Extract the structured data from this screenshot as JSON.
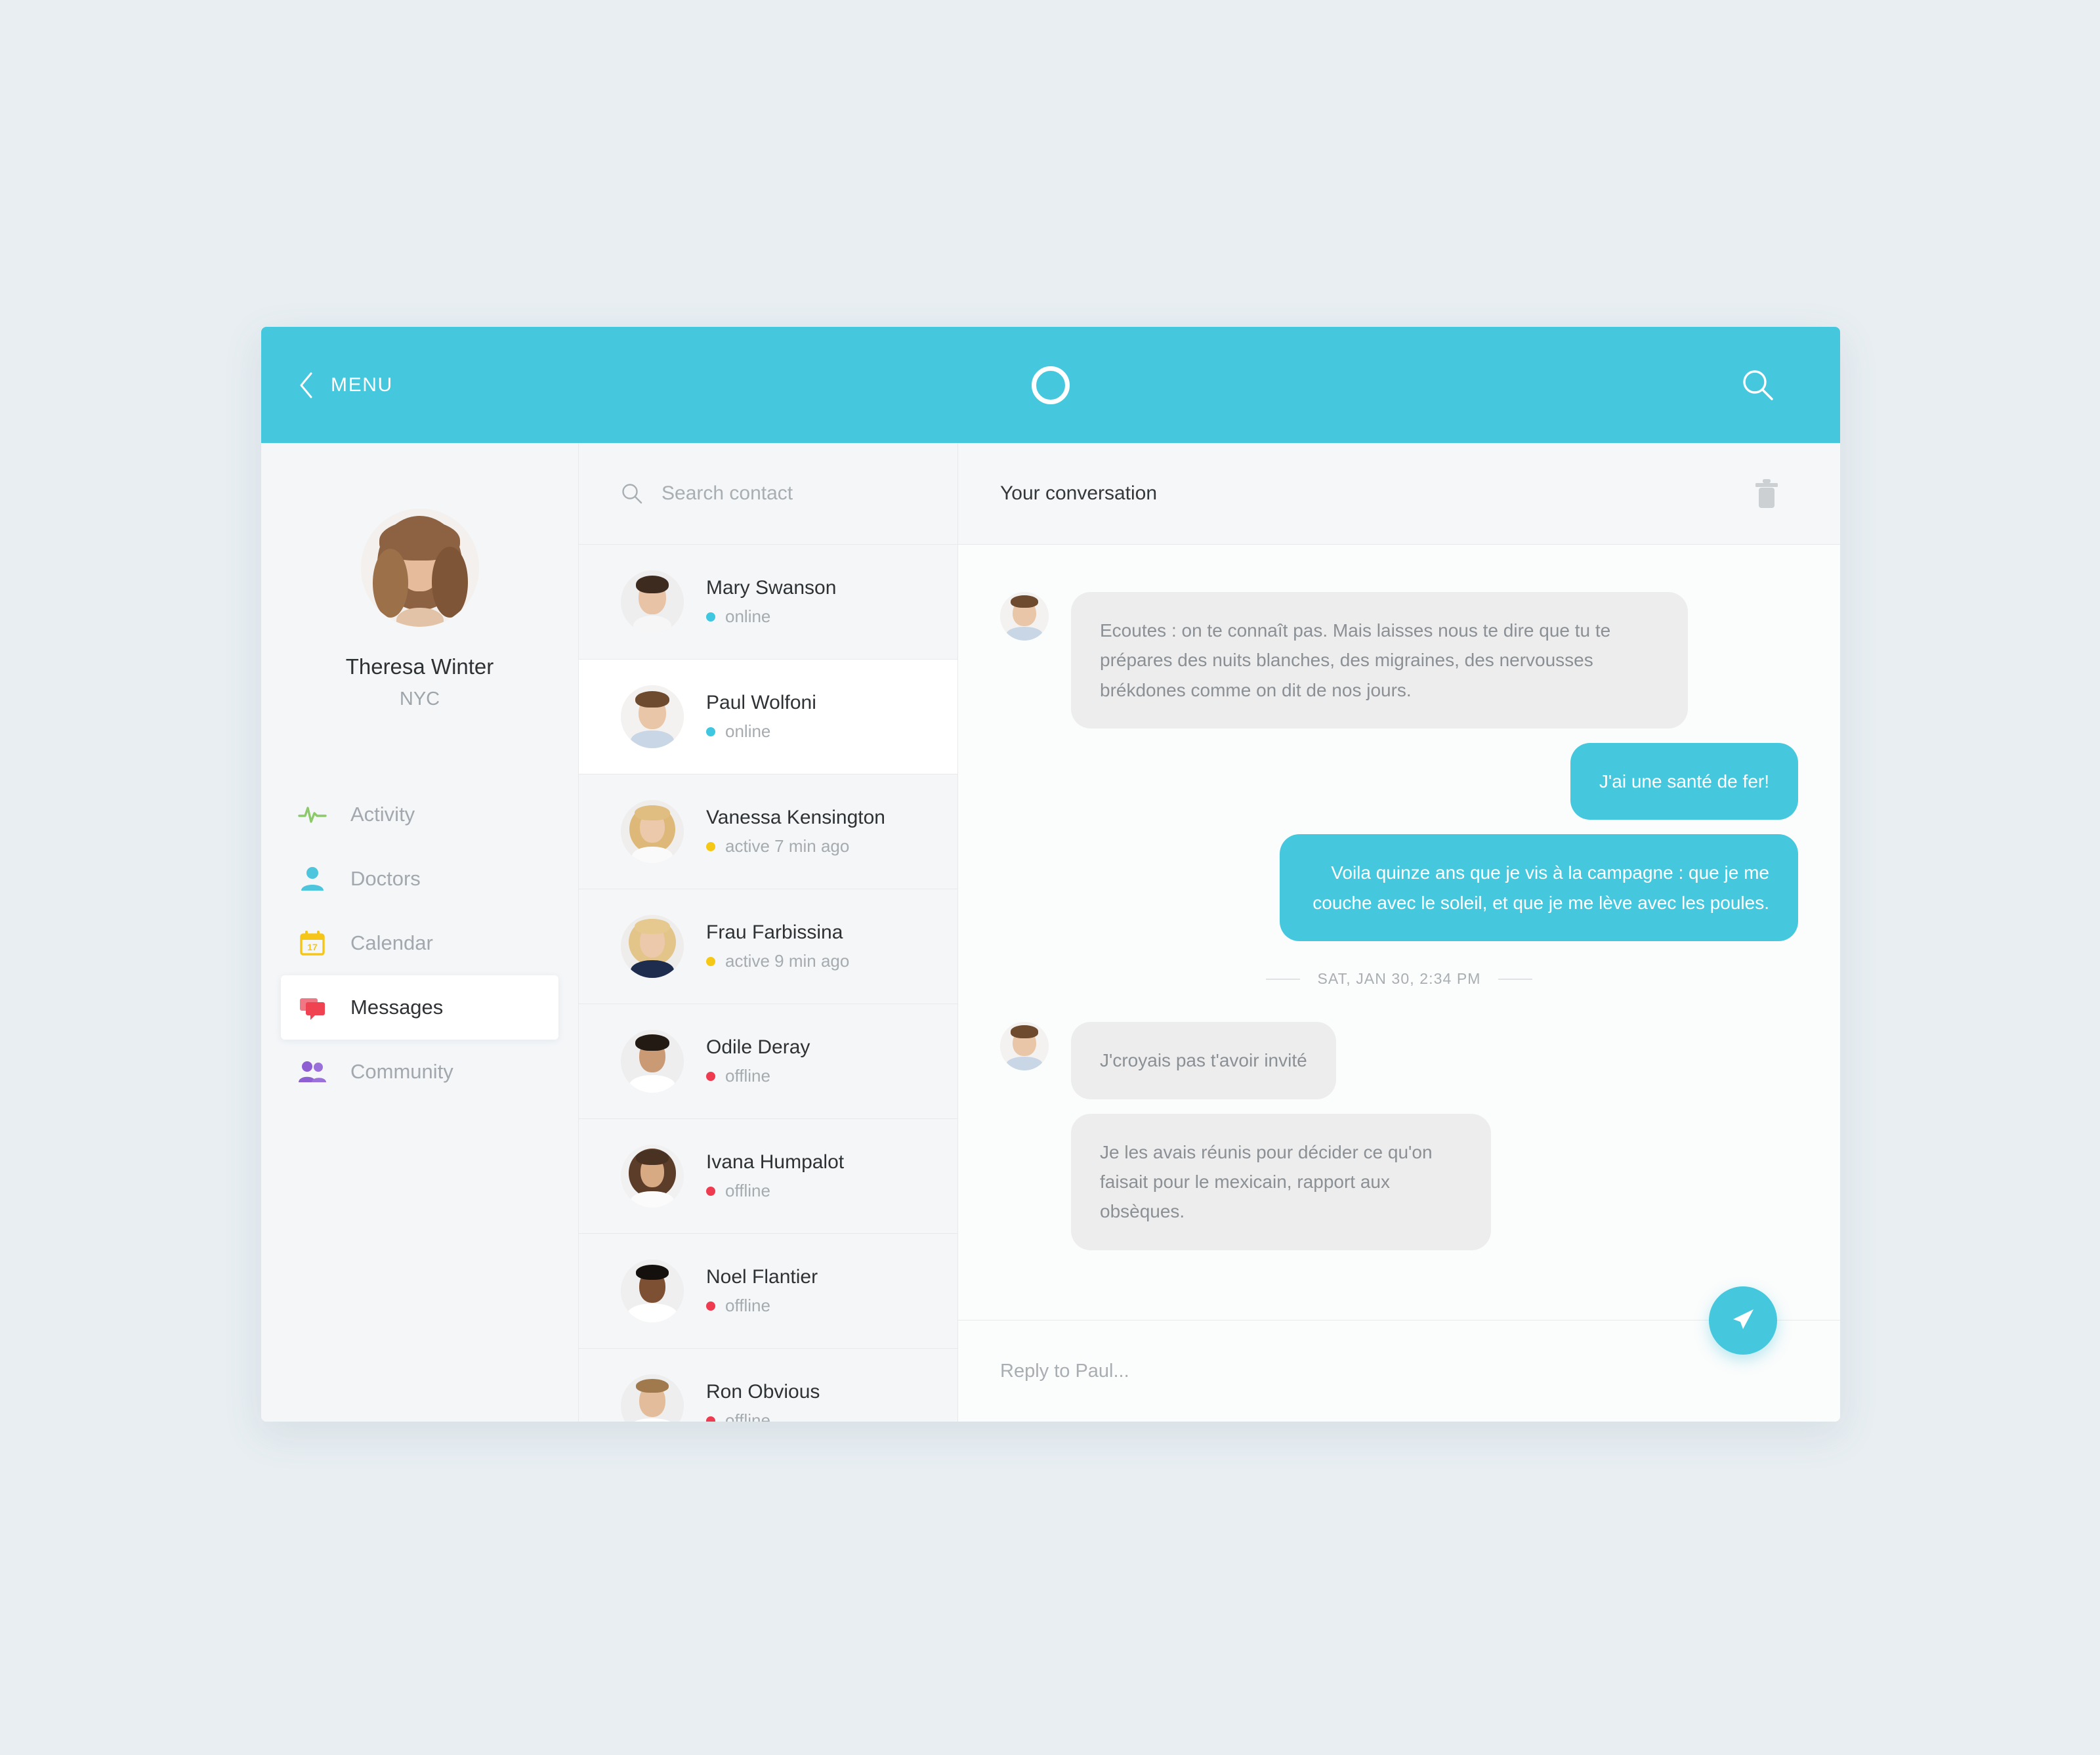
{
  "topbar": {
    "menu_label": "MENU",
    "back_icon": "chevron-left-icon",
    "logo_icon": "circle-logo-icon",
    "search_icon": "search-icon",
    "accent_color": "#45c8de"
  },
  "sidebar": {
    "profile": {
      "name": "Theresa Winter",
      "location": "NYC",
      "avatar_icon": "user-avatar"
    },
    "items": [
      {
        "label": "Activity",
        "icon": "activity-pulse-icon",
        "color": "#8cc96a",
        "active": false
      },
      {
        "label": "Doctors",
        "icon": "person-icon",
        "color": "#4cc5dd",
        "active": false
      },
      {
        "label": "Calendar",
        "icon": "calendar-icon",
        "color": "#f5c517",
        "active": false
      },
      {
        "label": "Messages",
        "icon": "chat-bubbles-icon",
        "color": "#ef4352",
        "active": true
      },
      {
        "label": "Community",
        "icon": "people-group-icon",
        "color": "#8d5fd3",
        "active": false
      }
    ]
  },
  "contacts": {
    "search": {
      "placeholder": "Search contact",
      "icon": "search-icon",
      "value": ""
    },
    "items": [
      {
        "name": "Mary Swanson",
        "status": "online",
        "dot_color": "#3fc6e0",
        "selected": false
      },
      {
        "name": "Paul Wolfoni",
        "status": "online",
        "dot_color": "#3fc6e0",
        "selected": true
      },
      {
        "name": "Vanessa Kensington",
        "status": "active 7 min ago",
        "dot_color": "#f6c816",
        "selected": false
      },
      {
        "name": "Frau Farbissina",
        "status": "active 9 min ago",
        "dot_color": "#f6c816",
        "selected": false
      },
      {
        "name": "Odile Deray",
        "status": "offline",
        "dot_color": "#ef3b4f",
        "selected": false
      },
      {
        "name": "Ivana Humpalot",
        "status": "offline",
        "dot_color": "#ef3b4f",
        "selected": false
      },
      {
        "name": "Noel Flantier",
        "status": "offline",
        "dot_color": "#ef3b4f",
        "selected": false
      },
      {
        "name": "Ron Obvious",
        "status": "offline",
        "dot_color": "#ef3b4f",
        "selected": false
      }
    ]
  },
  "conversation": {
    "title": "Your conversation",
    "delete_icon": "trash-icon",
    "messages": [
      {
        "direction": "in",
        "text": "Ecoutes : on te connaît pas. Mais laisses nous te dire que tu te prépares des nuits blanches, des migraines, des nervousses brékdones comme on dit de nos jours.",
        "avatar": true
      },
      {
        "direction": "out",
        "text": "J'ai une santé de fer!",
        "avatar": false
      },
      {
        "direction": "out",
        "text": "Voila quinze ans que je vis à la campagne : que je me couche avec le soleil, et que je me lève avec les poules.",
        "avatar": false
      }
    ],
    "date_separator": "SAT, JAN 30, 2:34 PM",
    "messages_after": [
      {
        "direction": "in",
        "text": "J'croyais pas t'avoir invité",
        "avatar": true
      },
      {
        "direction": "in",
        "text": "Je les avais réunis pour décider ce qu'on faisait pour le mexicain, rapport aux obsèques.",
        "avatar": false
      }
    ],
    "reply": {
      "placeholder": "Reply to Paul...",
      "value": "",
      "send_icon": "send-paper-plane-icon"
    }
  }
}
